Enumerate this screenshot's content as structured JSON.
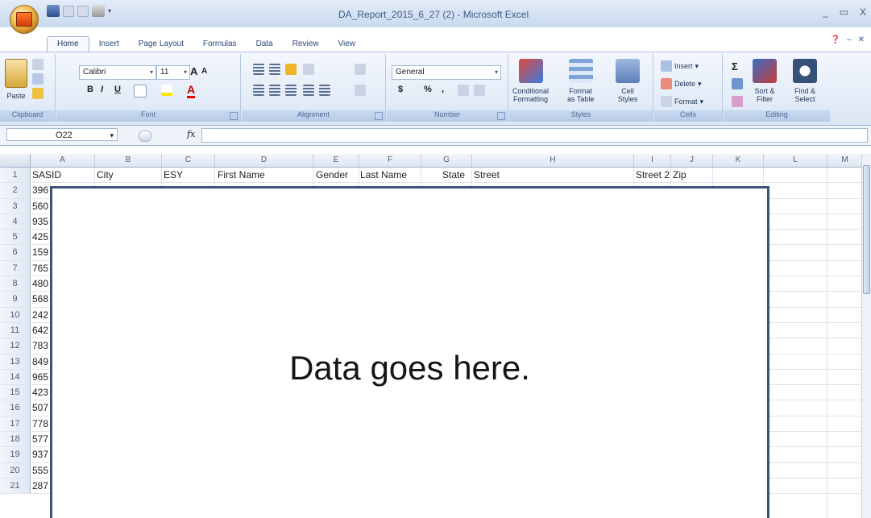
{
  "window": {
    "title": "DA_Report_2015_6_27 (2) - Microsoft Excel",
    "controls": [
      "_",
      "▭",
      "X"
    ]
  },
  "ribbon": {
    "tabs": [
      "Home",
      "Insert",
      "Page Layout",
      "Formulas",
      "Data",
      "Review",
      "View"
    ],
    "active_tab": "Home",
    "clipboard": {
      "paste": "Paste",
      "label": "Clipboard"
    },
    "font": {
      "family": "Calibri",
      "size": "11",
      "label": "Font",
      "bold": "B",
      "italic": "I",
      "underline": "U",
      "grow": "A",
      "shrink": "A",
      "color": "A"
    },
    "alignment": {
      "label": "Alignment"
    },
    "number": {
      "format": "General",
      "currency": "$",
      "percent": "%",
      "comma": ",",
      "label": "Number"
    },
    "styles": {
      "conditional": "Conditional\nFormatting",
      "table": "Format\nas Table",
      "cell": "Cell\nStyles",
      "label": "Styles"
    },
    "cells": {
      "insert": "Insert",
      "delete": "Delete",
      "format": "Format",
      "label": "Cells"
    },
    "editing": {
      "sum": "Σ",
      "sort": "Sort &\nFilter",
      "find": "Find &\nSelect",
      "label": "Editing"
    }
  },
  "formula_bar": {
    "name_box": "O22",
    "fx": "fx",
    "value": ""
  },
  "sheet": {
    "columns": [
      "A",
      "B",
      "C",
      "D",
      "E",
      "F",
      "G",
      "H",
      "I",
      "J",
      "K",
      "L",
      "M"
    ],
    "header_row": [
      "SASID",
      "City",
      "ESY",
      "First Name",
      "Gender",
      "Last Name",
      "State",
      "Street",
      "Street 2",
      "Zip"
    ],
    "rows": [
      {
        "n": "1",
        "a": ""
      },
      {
        "n": "2",
        "a": "396"
      },
      {
        "n": "3",
        "a": "560"
      },
      {
        "n": "4",
        "a": "935"
      },
      {
        "n": "5",
        "a": "425"
      },
      {
        "n": "6",
        "a": "159"
      },
      {
        "n": "7",
        "a": "765"
      },
      {
        "n": "8",
        "a": "480"
      },
      {
        "n": "9",
        "a": "568"
      },
      {
        "n": "10",
        "a": "242"
      },
      {
        "n": "11",
        "a": "642"
      },
      {
        "n": "12",
        "a": "783"
      },
      {
        "n": "13",
        "a": "849"
      },
      {
        "n": "14",
        "a": "965"
      },
      {
        "n": "15",
        "a": "423"
      },
      {
        "n": "16",
        "a": "507"
      },
      {
        "n": "17",
        "a": "778"
      },
      {
        "n": "18",
        "a": "577"
      },
      {
        "n": "19",
        "a": "937"
      },
      {
        "n": "20",
        "a": "555"
      },
      {
        "n": "21",
        "a": "287"
      }
    ]
  },
  "overlay": {
    "text": "Data goes here."
  }
}
